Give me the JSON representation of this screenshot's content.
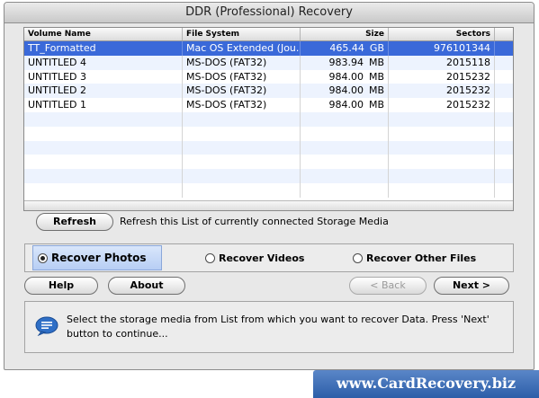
{
  "window": {
    "title": "DDR (Professional) Recovery"
  },
  "table": {
    "headers": [
      "Volume Name",
      "File System",
      "Size",
      "Sectors"
    ],
    "rows": [
      {
        "name": "TT_Formatted",
        "fs": "Mac OS Extended (Jou...",
        "size": "465.44",
        "unit": "GB",
        "sectors": "976101344",
        "selected": true
      },
      {
        "name": "UNTITLED 4",
        "fs": "MS-DOS (FAT32)",
        "size": "983.94",
        "unit": "MB",
        "sectors": "2015118"
      },
      {
        "name": "UNTITLED 3",
        "fs": "MS-DOS (FAT32)",
        "size": "984.00",
        "unit": "MB",
        "sectors": "2015232"
      },
      {
        "name": "UNTITLED 2",
        "fs": "MS-DOS (FAT32)",
        "size": "984.00",
        "unit": "MB",
        "sectors": "2015232"
      },
      {
        "name": "UNTITLED 1",
        "fs": "MS-DOS (FAT32)",
        "size": "984.00",
        "unit": "MB",
        "sectors": "2015232"
      }
    ]
  },
  "refresh": {
    "button_label": "Refresh",
    "description": "Refresh this List of currently connected Storage Media"
  },
  "recovery_options": {
    "selected": "photos",
    "photos_label": "Recover Photos",
    "videos_label": "Recover Videos",
    "other_label": "Recover Other Files"
  },
  "buttons": {
    "help": "Help",
    "about": "About",
    "back": "< Back",
    "next": "Next >"
  },
  "message": "Select the storage media from List from which you want to recover Data. Press 'Next' button to continue...",
  "footer": {
    "banner": "www.CardRecovery.biz"
  },
  "colors": {
    "selection": "#3a69d9",
    "banner": "#2c5ea8"
  }
}
